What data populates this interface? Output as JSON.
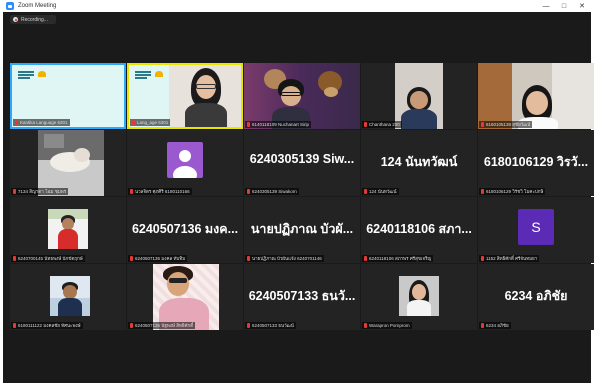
{
  "window": {
    "title": "Zoom Meeting",
    "controls": {
      "minimize": "—",
      "maximize": "□",
      "close": "✕"
    }
  },
  "recording": {
    "label": "Recording..."
  },
  "colors": {
    "speaker_highlight": "#e6e600",
    "pinned_highlight": "#2aa9ff",
    "avatar_purple": "#9b59d0",
    "letter_purple": "#5b2bb5",
    "muted_mic": "#e53935"
  },
  "participants": [
    {
      "id": "p1",
      "name": "Kantika Language 6301",
      "display": "slide"
    },
    {
      "id": "p2",
      "name": "Lang_age 6301",
      "display": "video-speaker"
    },
    {
      "id": "p3",
      "name": "6140118109 Nuchanart Sirip",
      "display": "video"
    },
    {
      "id": "p4",
      "name": "Chanthana 200",
      "display": "video"
    },
    {
      "id": "p5",
      "name": "6160105138 สุชัยวัฒน์",
      "display": "video"
    },
    {
      "id": "p6",
      "name": "7134 สิญาดา โฉม ชุมพร",
      "display": "video"
    },
    {
      "id": "p7",
      "name": "นวลจิตร ศุภศิริ 6180110166",
      "display": "avatar"
    },
    {
      "id": "p8",
      "name": "6240305139 Siwakorn",
      "big": "6240305139 Siw...",
      "display": "name"
    },
    {
      "id": "p9",
      "name": "124 นันทวัฒน์",
      "big": "124 นันทวัฒน์",
      "display": "name"
    },
    {
      "id": "p10",
      "name": "6180106129 วิรัชวิ โมคะปกษิ",
      "big": "6180106129 วิรวั...",
      "display": "name"
    },
    {
      "id": "p11",
      "name": "6240700145 นัทธพงษ์ นักขัตฤกษ์",
      "display": "video"
    },
    {
      "id": "p12",
      "name": "6240507136 มงคล ทับทิม",
      "big": "6240507136 มงค...",
      "display": "name"
    },
    {
      "id": "p13",
      "name": "นายปฏิภาณ บัวผันแจ้ง 6240701146",
      "big": "นายปฏิภาณ บัวผั...",
      "display": "name"
    },
    {
      "id": "p14",
      "name": "6240118106 สภาพร ศรีสุขเจริญ",
      "big": "6240118106 สภา...",
      "display": "name"
    },
    {
      "id": "p15",
      "name": "1152 สิทธิศักดิ์ ศรีจันทมยา",
      "letter": "S",
      "display": "letter"
    },
    {
      "id": "p16",
      "name": "6180111122 มงคลชัย ทัศนะพงษ์",
      "display": "video"
    },
    {
      "id": "p17",
      "name": "6240507135 นัฐพงษ์ สิทธิศักดิ์",
      "display": "video"
    },
    {
      "id": "p18",
      "name": "6240507133 ธนวัฒน์",
      "big": "6240507133 ธนวั...",
      "display": "name"
    },
    {
      "id": "p19",
      "name": "Warapron Pornprom",
      "display": "video"
    },
    {
      "id": "p20",
      "name": "6234 อภิชัย",
      "big": "6234 อภิชัย",
      "display": "name"
    }
  ]
}
